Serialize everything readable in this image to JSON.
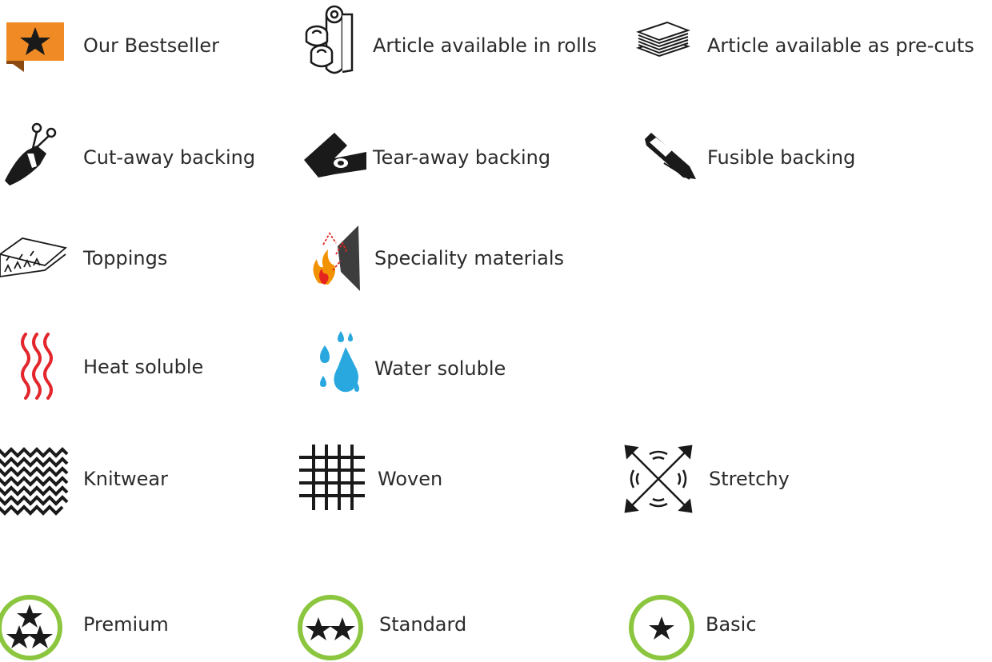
{
  "colors": {
    "ink": "#1a1a1a",
    "bestseller_orange": "#f08a24",
    "bestseller_fold": "#8a4a12",
    "heat_red": "#e3262c",
    "water_blue": "#29a8e0",
    "quality_green": "#8cc63f",
    "flame_orange": "#f39200",
    "flame_red": "#e52421"
  },
  "legend": {
    "bestseller": {
      "label": "Our Bestseller",
      "icon": "orange-star-flag-icon"
    },
    "rolls": {
      "label": "Article available in rolls",
      "icon": "paper-rolls-icon"
    },
    "precuts": {
      "label": "Article available as pre-cuts",
      "icon": "sheet-stack-icon"
    },
    "cutaway": {
      "label": "Cut-away backing",
      "icon": "scissors-hand-icon"
    },
    "tearaway": {
      "label": "Tear-away backing",
      "icon": "tearing-hand-icon"
    },
    "fusible": {
      "label": "Fusible backing",
      "icon": "iron-icon"
    },
    "toppings": {
      "label": "Toppings",
      "icon": "topping-sheet-icon"
    },
    "speciality": {
      "label": "Speciality materials",
      "icon": "flame-panel-icon"
    },
    "heat_soluble": {
      "label": "Heat soluble",
      "icon": "heat-waves-icon"
    },
    "water_soluble": {
      "label": "Water soluble",
      "icon": "water-drops-icon"
    },
    "knitwear": {
      "label": "Knitwear",
      "icon": "knit-pattern-icon"
    },
    "woven": {
      "label": "Woven",
      "icon": "woven-grid-icon"
    },
    "stretchy": {
      "label": "Stretchy",
      "icon": "stretch-arrows-icon"
    },
    "premium": {
      "label": "Premium",
      "icon": "three-stars-circle-icon",
      "stars": 3
    },
    "standard": {
      "label": "Standard",
      "icon": "two-stars-circle-icon",
      "stars": 2
    },
    "basic": {
      "label": "Basic",
      "icon": "one-star-circle-icon",
      "stars": 1
    }
  }
}
